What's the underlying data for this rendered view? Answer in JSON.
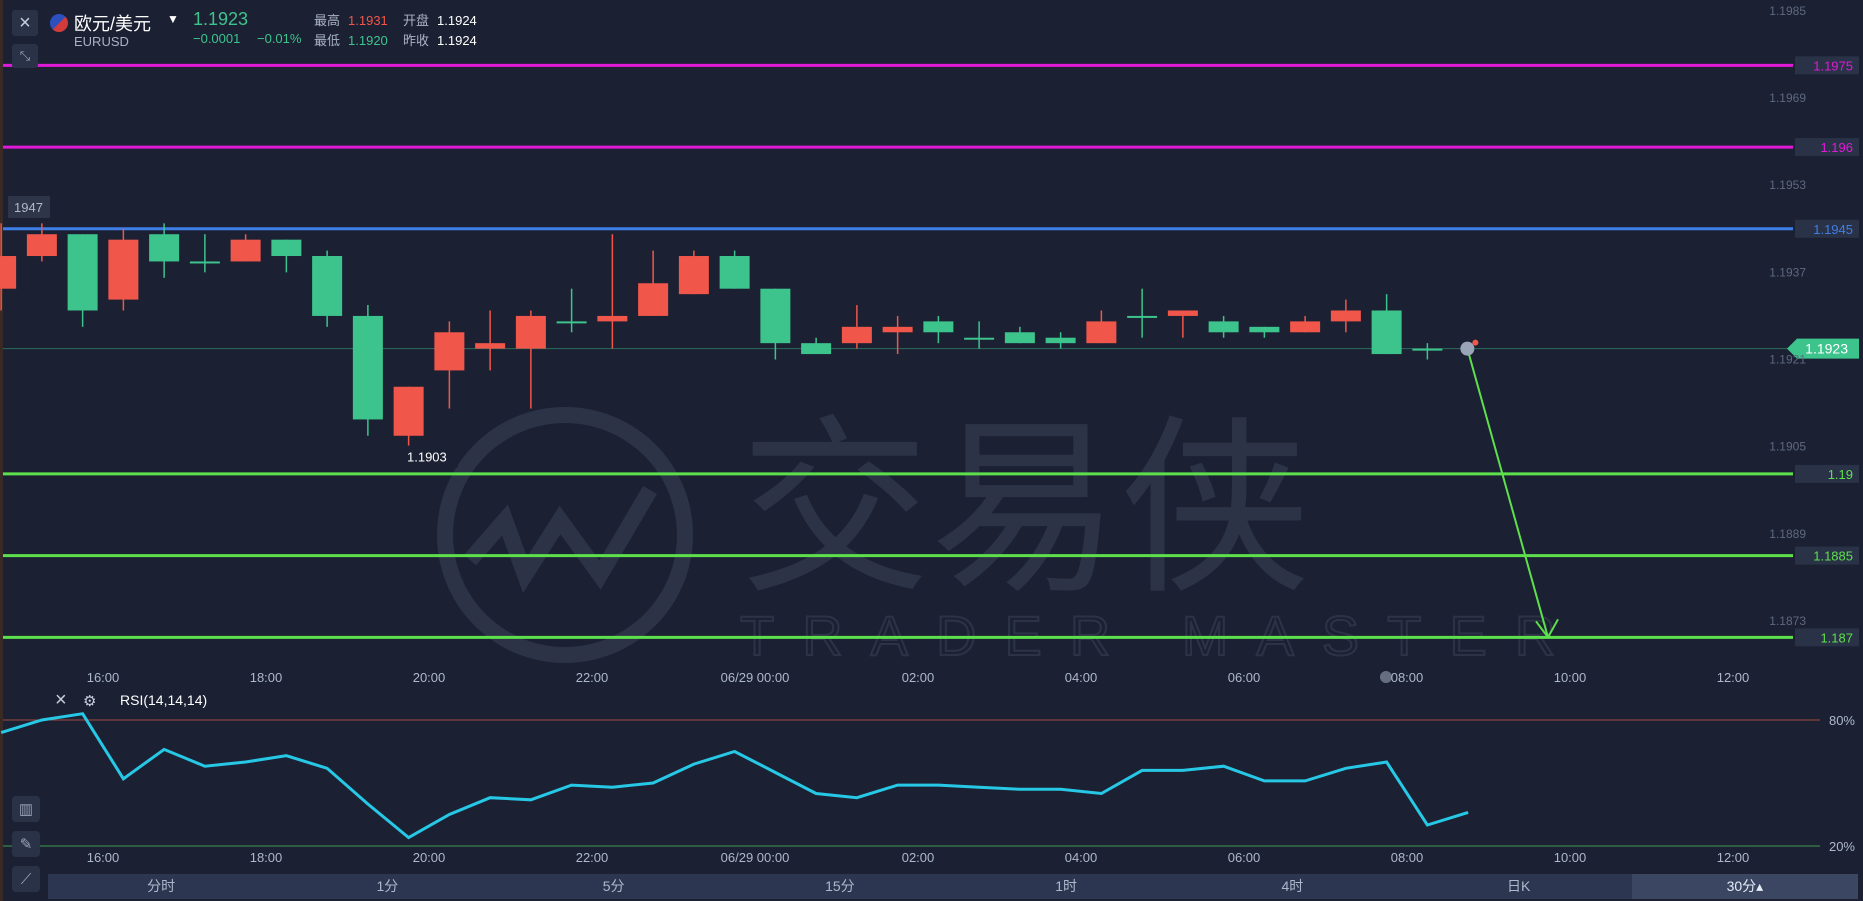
{
  "header": {
    "pair": "欧元/美元",
    "symbol": "EURUSD",
    "price": "1.1923",
    "change": "−0.0001",
    "change_pct": "−0.01%",
    "high_label": "最高",
    "high": "1.1931",
    "low_label": "最低",
    "low": "1.1920",
    "open_label": "开盘",
    "open": "1.1924",
    "prev_label": "昨收",
    "prev_close": "1.1924"
  },
  "colors": {
    "up": "#3dc48d",
    "down": "#f0564a",
    "magenta": "#e01ad8",
    "blue": "#3e7ee8",
    "green_level": "#5de04b",
    "rsi": "#27c8e6"
  },
  "chart_data": [
    {
      "type": "candlestick",
      "symbol": "EURUSD",
      "interval": "30分",
      "x_ticks": [
        "16:00",
        "18:00",
        "20:00",
        "22:00",
        "06/29 00:00",
        "02:00",
        "04:00",
        "06:00",
        "08:00",
        "10:00",
        "12:00"
      ],
      "y_ticks": [
        "1.1985",
        "1.1969",
        "1.1953",
        "1.1937",
        "1.1921",
        "1.1905",
        "1.1889",
        "1.1873"
      ],
      "ylim": [
        1.1864,
        1.1987
      ],
      "candles": [
        {
          "o": 1.194,
          "h": 1.1946,
          "l": 1.193,
          "c": 1.1934
        },
        {
          "o": 1.1944,
          "h": 1.1946,
          "l": 1.1939,
          "c": 1.194
        },
        {
          "o": 1.193,
          "h": 1.1944,
          "l": 1.1927,
          "c": 1.1944
        },
        {
          "o": 1.1943,
          "h": 1.1945,
          "l": 1.193,
          "c": 1.1932
        },
        {
          "o": 1.1939,
          "h": 1.1946,
          "l": 1.1936,
          "c": 1.1944
        },
        {
          "o": 1.1939,
          "h": 1.1944,
          "l": 1.1937,
          "c": 1.1939
        },
        {
          "o": 1.1943,
          "h": 1.1944,
          "l": 1.1939,
          "c": 1.1939
        },
        {
          "o": 1.194,
          "h": 1.1943,
          "l": 1.1937,
          "c": 1.1943
        },
        {
          "o": 1.1929,
          "h": 1.1941,
          "l": 1.1927,
          "c": 1.194
        },
        {
          "o": 1.191,
          "h": 1.1931,
          "l": 1.1907,
          "c": 1.1929
        },
        {
          "o": 1.1916,
          "h": 1.1916,
          "l": 1.1903,
          "c": 1.1907
        },
        {
          "o": 1.1926,
          "h": 1.1928,
          "l": 1.1912,
          "c": 1.1919
        },
        {
          "o": 1.1924,
          "h": 1.193,
          "l": 1.1919,
          "c": 1.1923
        },
        {
          "o": 1.1929,
          "h": 1.193,
          "l": 1.1912,
          "c": 1.1923
        },
        {
          "o": 1.1928,
          "h": 1.1934,
          "l": 1.1926,
          "c": 1.1928
        },
        {
          "o": 1.1929,
          "h": 1.1944,
          "l": 1.1923,
          "c": 1.1928
        },
        {
          "o": 1.1935,
          "h": 1.1941,
          "l": 1.1929,
          "c": 1.1929
        },
        {
          "o": 1.194,
          "h": 1.1941,
          "l": 1.1933,
          "c": 1.1933
        },
        {
          "o": 1.1934,
          "h": 1.1941,
          "l": 1.1934,
          "c": 1.194
        },
        {
          "o": 1.1924,
          "h": 1.1934,
          "l": 1.1921,
          "c": 1.1934
        },
        {
          "o": 1.1922,
          "h": 1.1925,
          "l": 1.1922,
          "c": 1.1924
        },
        {
          "o": 1.1927,
          "h": 1.1931,
          "l": 1.1923,
          "c": 1.1924
        },
        {
          "o": 1.1927,
          "h": 1.1929,
          "l": 1.1922,
          "c": 1.1926
        },
        {
          "o": 1.1926,
          "h": 1.1929,
          "l": 1.1924,
          "c": 1.1928
        },
        {
          "o": 1.1925,
          "h": 1.1928,
          "l": 1.1923,
          "c": 1.1925
        },
        {
          "o": 1.1924,
          "h": 1.1927,
          "l": 1.1924,
          "c": 1.1926
        },
        {
          "o": 1.1924,
          "h": 1.1926,
          "l": 1.1923,
          "c": 1.1925
        },
        {
          "o": 1.1928,
          "h": 1.193,
          "l": 1.1924,
          "c": 1.1924
        },
        {
          "o": 1.1929,
          "h": 1.1934,
          "l": 1.1925,
          "c": 1.1929
        },
        {
          "o": 1.193,
          "h": 1.193,
          "l": 1.1925,
          "c": 1.1929
        },
        {
          "o": 1.1926,
          "h": 1.1929,
          "l": 1.1925,
          "c": 1.1928
        },
        {
          "o": 1.1926,
          "h": 1.1927,
          "l": 1.1925,
          "c": 1.1927
        },
        {
          "o": 1.1928,
          "h": 1.1929,
          "l": 1.1926,
          "c": 1.1926
        },
        {
          "o": 1.193,
          "h": 1.1932,
          "l": 1.1926,
          "c": 1.1928
        },
        {
          "o": 1.1922,
          "h": 1.1933,
          "l": 1.1922,
          "c": 1.193
        },
        {
          "o": 1.1923,
          "h": 1.1924,
          "l": 1.1921,
          "c": 1.1923
        }
      ],
      "last_price": "1.1923",
      "horizontal_levels": [
        {
          "value": 1.1975,
          "label": "1.1975",
          "color": "#e01ad8"
        },
        {
          "value": 1.196,
          "label": "1.196",
          "color": "#e01ad8"
        },
        {
          "value": 1.1945,
          "label": "1.1945",
          "color": "#3e7ee8"
        },
        {
          "value": 1.19,
          "label": "1.19",
          "color": "#5de04b"
        },
        {
          "value": 1.1885,
          "label": "1.1885",
          "color": "#5de04b"
        },
        {
          "value": 1.187,
          "label": "1.187",
          "color": "#5de04b"
        }
      ],
      "annotations": [
        "1947",
        "1.1903"
      ],
      "arrow": {
        "from_price": 1.1923,
        "to_price": 1.187,
        "color": "#5de04b"
      },
      "watermark": {
        "cn": "交易侠",
        "en": "TRADER MASTER"
      }
    },
    {
      "type": "line",
      "title": "RSI(14,14,14)",
      "ylim": [
        0,
        100
      ],
      "y_ticks": [
        "80%",
        "20%"
      ],
      "levels": [
        80,
        20
      ],
      "x_ticks": [
        "16:00",
        "18:00",
        "20:00",
        "22:00",
        "06/29 00:00",
        "02:00",
        "04:00",
        "06:00",
        "08:00",
        "10:00",
        "12:00"
      ],
      "values": [
        74,
        80,
        83,
        52,
        66,
        58,
        60,
        63,
        57,
        40,
        24,
        35,
        43,
        42,
        49,
        48,
        50,
        59,
        65,
        55,
        45,
        43,
        49,
        49,
        48,
        47,
        47,
        45,
        56,
        56,
        58,
        51,
        51,
        57,
        60,
        30,
        36
      ]
    }
  ],
  "indicator_panel": {
    "label": "RSI(14,14,14)"
  },
  "timeframes": [
    "分时",
    "1分",
    "5分",
    "15分",
    "1时",
    "4时",
    "日K",
    "30分▴"
  ],
  "active_timeframe": 7,
  "toolbar": {
    "close": "×",
    "collapse": "⤡",
    "rsi_close": "×",
    "rsi_settings": "⚙"
  }
}
